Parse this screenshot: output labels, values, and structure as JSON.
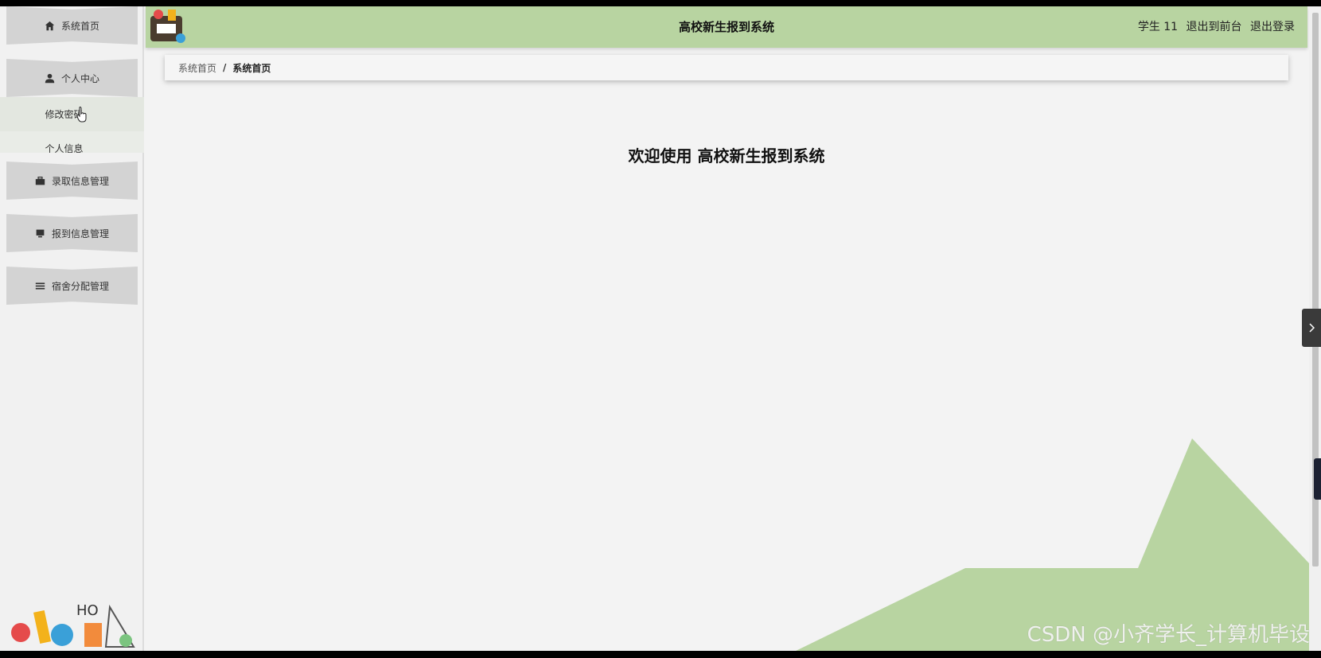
{
  "app": {
    "title": "高校新生报到系统",
    "colors": {
      "header": "#b8d4a1",
      "sidebar": "#f1f1f1",
      "menu_button": "#d3d3d3",
      "accent_shape": "#b8d4a1"
    }
  },
  "header": {
    "user_name": "学生 11",
    "links": {
      "front": "退出到前台",
      "logout": "退出登录"
    }
  },
  "sidebar": {
    "items": [
      {
        "label": "系统首页",
        "icon": "home-icon"
      },
      {
        "label": "个人中心",
        "icon": "user-icon"
      },
      {
        "label": "录取信息管理",
        "icon": "briefcase-icon"
      },
      {
        "label": "报到信息管理",
        "icon": "monitor-icon"
      },
      {
        "label": "宿舍分配管理",
        "icon": "list-icon"
      }
    ],
    "submenu": [
      {
        "label": "修改密码"
      },
      {
        "label": "个人信息"
      }
    ]
  },
  "breadcrumb": {
    "home": "系统首页",
    "separator": "/",
    "current": "系统首页"
  },
  "main": {
    "welcome": "欢迎使用 高校新生报到系统"
  },
  "watermark": "CSDN @小齐学长_计算机毕设"
}
